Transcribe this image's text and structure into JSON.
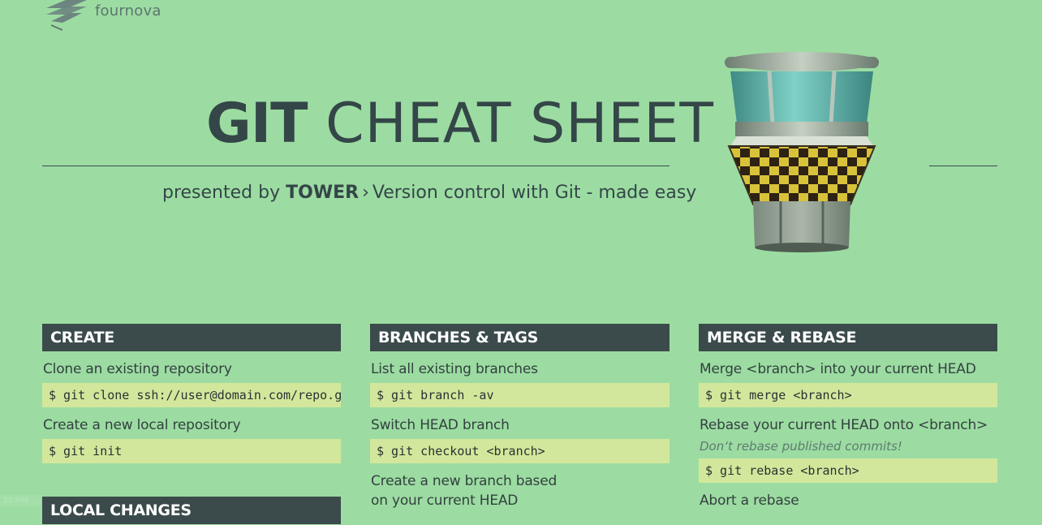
{
  "brand": {
    "name": "fournova"
  },
  "header": {
    "title_bold": "GIT",
    "title_light": "CHEAT SHEET",
    "presented_by": "presented by",
    "product": "TOWER",
    "chevron": "›",
    "tagline": "Version control with Git - made easy"
  },
  "columns": [
    {
      "heading": "CREATE",
      "items": [
        {
          "desc": "Clone an existing repository",
          "cmd": "$ git clone ssh://user@domain.com/repo.git"
        },
        {
          "desc": "Create a new local repository",
          "cmd": "$ git init"
        }
      ]
    },
    {
      "heading": "BRANCHES & TAGS",
      "items": [
        {
          "desc": "List all existing branches",
          "cmd": "$ git branch -av"
        },
        {
          "desc": "Switch HEAD branch",
          "cmd": "$ git checkout <branch>"
        },
        {
          "desc_line1": "Create a new branch based",
          "desc_line2": "on your current HEAD"
        }
      ]
    },
    {
      "heading": "MERGE & REBASE",
      "items": [
        {
          "desc": "Merge <branch> into your current HEAD",
          "cmd": "$ git merge <branch>"
        },
        {
          "desc": "Rebase your current HEAD onto <branch>",
          "note": "Don‘t rebase published commits!",
          "cmd": "$ git rebase <branch>"
        },
        {
          "desc": "Abort a rebase"
        }
      ]
    }
  ],
  "section2": {
    "heading": "LOCAL CHANGES"
  },
  "status": {
    "zoom": "20.996 ..."
  },
  "colors": {
    "background": "#9cdca2",
    "header_bar": "#3b4b4b",
    "command_bg": "#d2e79b",
    "text": "#344648"
  },
  "icons": {
    "logo": "fournova-logo-icon",
    "tower": "tower-app-icon"
  }
}
